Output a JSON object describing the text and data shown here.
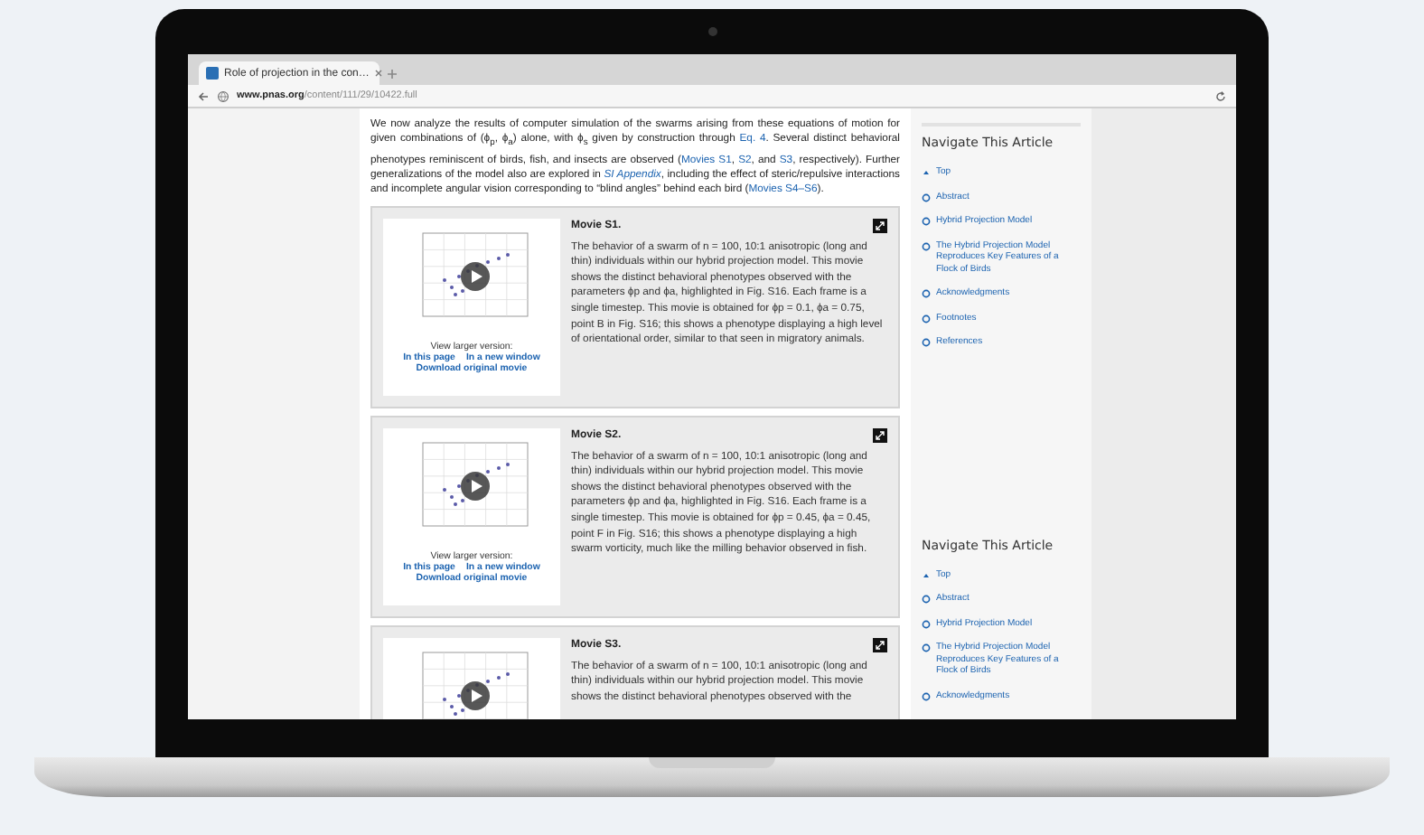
{
  "browser": {
    "tab": {
      "title": "Role of projection in the con…",
      "selected": true
    },
    "url_host": "www.pnas.org",
    "url_path": "/content/111/29/10422.full"
  },
  "article": {
    "paragraph": [
      {
        "text": "We now analyze the results of computer simulation of the swarms arising from these equations of motion for given combinations of (ϕ$_{p}$, ϕ$_{a}$) alone, with ϕ$_{s}$ given by construction through ",
        "link": false
      },
      {
        "text": "Eq. 4",
        "link": true
      },
      {
        "text": ". Several distinct behavioral phenotypes reminiscent of birds, fish, and insects are observed (",
        "link": false
      },
      {
        "text": "Movies S1",
        "link": true
      },
      {
        "text": ", ",
        "link": false
      },
      {
        "text": "S2",
        "link": true
      },
      {
        "text": ", and ",
        "link": false
      },
      {
        "text": "S3",
        "link": true
      },
      {
        "text": ", respectively). Further generalizations of the model also are explored in ",
        "link": false
      },
      {
        "text": "SI Appendix",
        "link": true,
        "italic": true
      },
      {
        "text": ", including the effect of steric/repulsive interactions and incomplete angular vision corresponding to “blind angles” behind each bird (",
        "link": false
      },
      {
        "text": "Movies S4–S6",
        "link": true
      },
      {
        "text": ").",
        "link": false
      }
    ],
    "movies": [
      {
        "title": "Movie S1.",
        "caption": "The behavior of a swarm of n = 100, 10:1 anisotropic (long and thin) individuals within our hybrid projection model. This movie shows the distinct behavioral phenotypes observed with the parameters ϕp and ϕa, highlighted in Fig. S16. Each frame is a single timestep. This movie is obtained for ϕp = 0.1, ϕa = 0.75, point B in Fig. S16; this shows a phenotype displaying a high level of orientational order, similar to that seen in migratory animals.",
        "view_label": "View larger version:",
        "links": [
          "In this page",
          "In a new window"
        ],
        "download": "Download original movie"
      },
      {
        "title": "Movie S2.",
        "caption": "The behavior of a swarm of n = 100, 10:1 anisotropic (long and thin) individuals within our hybrid projection model. This movie shows the distinct behavioral phenotypes observed with the parameters ϕp and ϕa, highlighted in Fig. S16. Each frame is a single timestep. This movie is obtained for ϕp = 0.45, ϕa = 0.45, point F in Fig. S16; this shows a phenotype displaying a high swarm vorticity, much like the milling behavior observed in fish.",
        "view_label": "View larger version:",
        "links": [
          "In this page",
          "In a new window"
        ],
        "download": "Download original movie"
      },
      {
        "title": "Movie S3.",
        "caption": "The behavior of a swarm of n = 100, 10:1 anisotropic (long and thin) individuals within our hybrid projection model. This movie shows the distinct behavioral phenotypes observed with the"
      }
    ]
  },
  "sidebar": [
    {
      "title": "Navigate This Article",
      "items": [
        {
          "label": "Top",
          "kind": "top"
        },
        {
          "label": "Abstract",
          "kind": "section"
        },
        {
          "label": "Hybrid Projection Model",
          "kind": "section"
        },
        {
          "label": "The Hybrid Projection Model Reproduces Key Features of a Flock of Birds",
          "kind": "section"
        },
        {
          "label": "Acknowledgments",
          "kind": "section"
        },
        {
          "label": "Footnotes",
          "kind": "section"
        },
        {
          "label": "References",
          "kind": "section"
        }
      ]
    },
    {
      "title": "Navigate This Article",
      "items": [
        {
          "label": "Top",
          "kind": "top"
        },
        {
          "label": "Abstract",
          "kind": "section"
        },
        {
          "label": "Hybrid Projection Model",
          "kind": "section"
        },
        {
          "label": "The Hybrid Projection Model Reproduces Key Features of a Flock of Birds",
          "kind": "section"
        },
        {
          "label": "Acknowledgments",
          "kind": "section"
        }
      ]
    }
  ]
}
